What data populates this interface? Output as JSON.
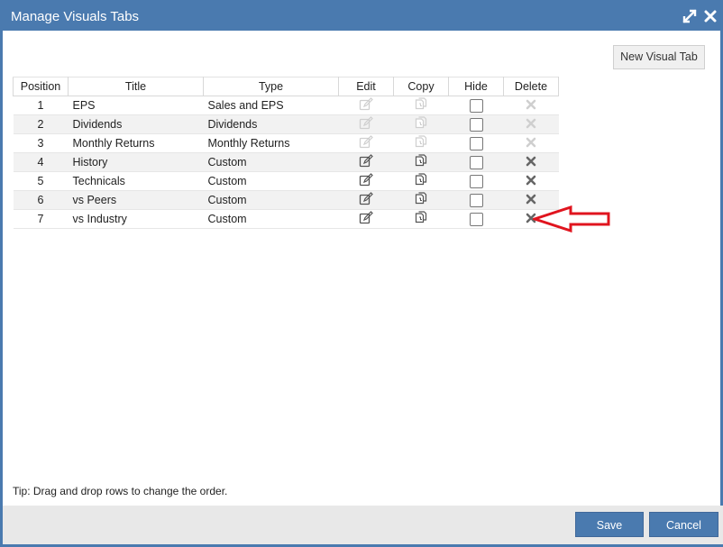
{
  "dialog": {
    "title": "Manage Visuals Tabs",
    "new_tab_label": "New Visual Tab",
    "tip": "Tip: Drag and drop rows to change the order.",
    "save_label": "Save",
    "cancel_label": "Cancel"
  },
  "table": {
    "headers": [
      "Position",
      "Title",
      "Type",
      "Edit",
      "Copy",
      "Hide",
      "Delete"
    ],
    "rows": [
      {
        "position": "1",
        "title": "EPS",
        "type": "Sales and EPS",
        "enabled": false,
        "hidden": false
      },
      {
        "position": "2",
        "title": "Dividends",
        "type": "Dividends",
        "enabled": false,
        "hidden": false
      },
      {
        "position": "3",
        "title": "Monthly Returns",
        "type": "Monthly Returns",
        "enabled": false,
        "hidden": false
      },
      {
        "position": "4",
        "title": "History",
        "type": "Custom",
        "enabled": true,
        "hidden": false
      },
      {
        "position": "5",
        "title": "Technicals",
        "type": "Custom",
        "enabled": true,
        "hidden": false
      },
      {
        "position": "6",
        "title": "vs Peers",
        "type": "Custom",
        "enabled": true,
        "hidden": false
      },
      {
        "position": "7",
        "title": "vs Industry",
        "type": "Custom",
        "enabled": true,
        "hidden": false
      }
    ]
  },
  "icons": {
    "title_bar": [
      "expand-icon",
      "close-icon"
    ],
    "row_actions": [
      "edit-icon",
      "copy-icon",
      "checkbox",
      "delete-icon"
    ],
    "annotation": "arrow-annotation"
  },
  "colors": {
    "accent": "#4a7aaf",
    "annotation": "#e0141e",
    "icon_enabled": "#555555",
    "icon_disabled": "#cfcfcf"
  }
}
